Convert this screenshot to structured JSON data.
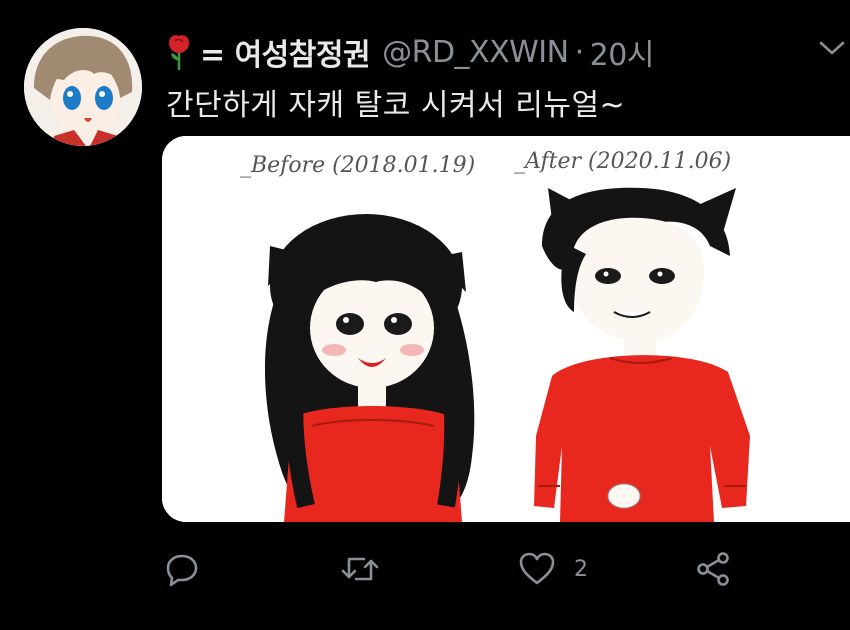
{
  "tweet": {
    "display_name": "= 여성참정권",
    "handle": "@RD_XXWIN",
    "separator": "·",
    "time": "20시",
    "text": "간단하게 자캐 탈코 시켜서 리뉴얼~",
    "media": {
      "before_caption": "_Before (2018.01.19)",
      "after_caption": "_After (2020.11.06)"
    },
    "actions": {
      "like_count": "2"
    }
  },
  "icons": {
    "name_prefix": "rose-icon",
    "menu": "chevron-down-icon",
    "reply": "reply-icon",
    "retweet": "retweet-icon",
    "like": "heart-icon",
    "share": "share-icon"
  },
  "colors": {
    "background": "#000000",
    "primary_text": "#e7e9ea",
    "secondary_text": "#8b9096",
    "sweater_red": "#e8281e"
  }
}
